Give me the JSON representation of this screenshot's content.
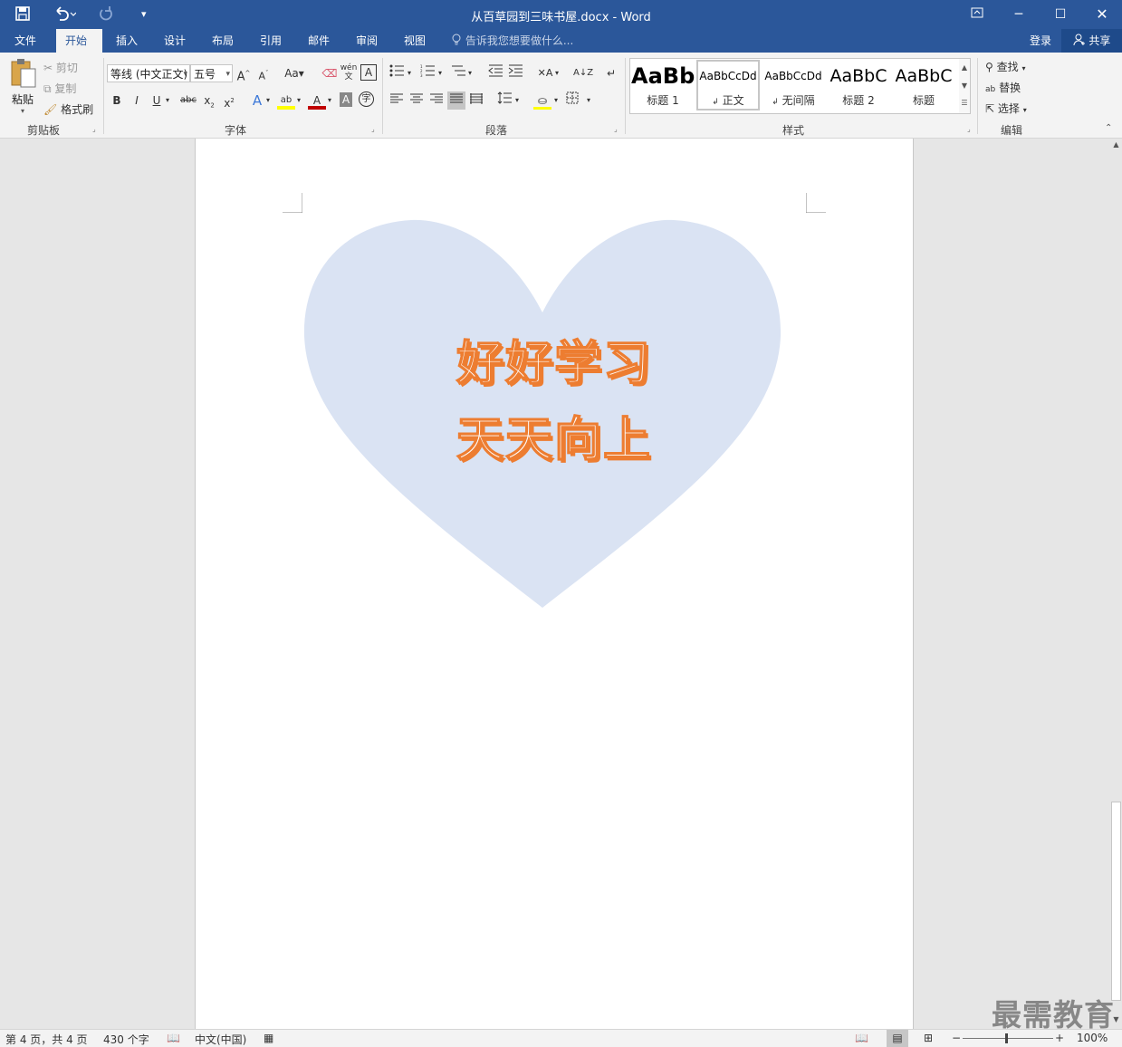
{
  "window": {
    "title": "从百草园到三味书屋.docx - Word"
  },
  "quick_access": {
    "save_icon": "save-icon",
    "undo_icon": "undo-icon",
    "redo_icon": "redo-icon",
    "customize_icon": "customize-icon"
  },
  "tabs": [
    "文件",
    "开始",
    "插入",
    "设计",
    "布局",
    "引用",
    "邮件",
    "审阅",
    "视图"
  ],
  "active_tab": "开始",
  "tellme": "告诉我您想要做什么...",
  "account": {
    "login": "登录",
    "share": "共享"
  },
  "clipboard": {
    "paste": "粘贴",
    "cut": "剪切",
    "copy": "复制",
    "format_painter": "格式刷",
    "label": "剪贴板"
  },
  "font": {
    "name": "等线 (中文正文)",
    "size": "五号",
    "label": "字体",
    "change_case": "Aa"
  },
  "paragraph": {
    "label": "段落"
  },
  "styles": {
    "label": "样式",
    "items": [
      {
        "sample": "AaBb",
        "name": "标题 1"
      },
      {
        "sample": "AaBbCcDd",
        "name": "正文"
      },
      {
        "sample": "AaBbCcDd",
        "name": "无间隔"
      },
      {
        "sample": "AaBbC",
        "name": "标题 2"
      },
      {
        "sample": "AaBbC",
        "name": "标题"
      }
    ]
  },
  "editing": {
    "label": "编辑",
    "find": "查找",
    "replace": "替换",
    "select": "选择"
  },
  "document": {
    "line1": "好好学习",
    "line2": "天天向上",
    "heart_color": "#dae3f3",
    "text_outline_color": "#ed7d31"
  },
  "status": {
    "page": "第 4 页，共 4 页",
    "words": "430 个字",
    "language": "中文(中国)",
    "zoom": "100%"
  },
  "watermark": "最需教育"
}
